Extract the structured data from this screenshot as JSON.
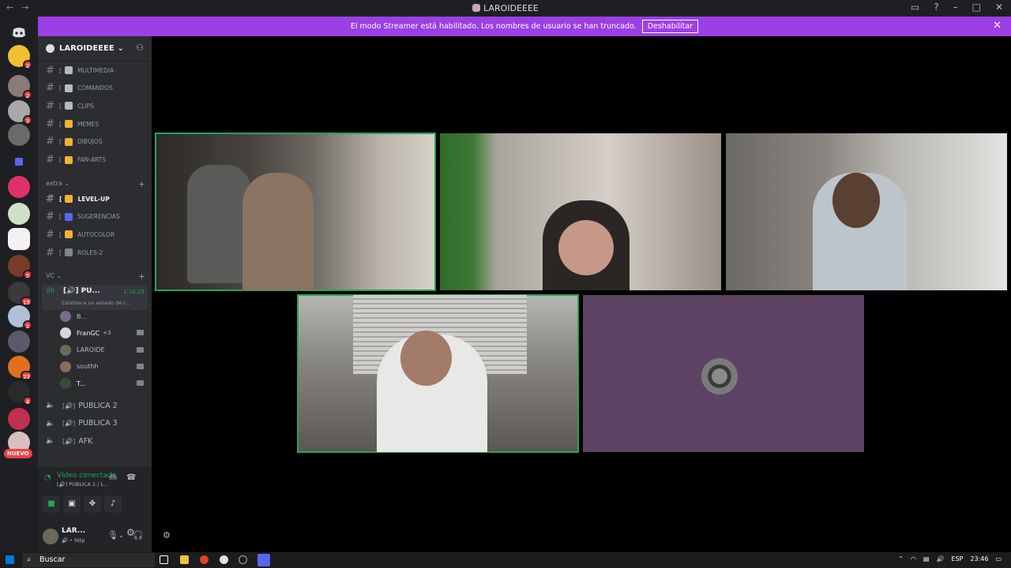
{
  "window": {
    "title": "LAROIDEEEE",
    "back_icon": "arrow-left-icon",
    "forward_icon": "arrow-right-icon"
  },
  "banner": {
    "text": "El modo Streamer está habilitado. Los nombres de usuario se han truncado.",
    "button": "Deshabilitar"
  },
  "server": {
    "name": "LAROIDEEEE"
  },
  "channels": [
    {
      "name": "MULTIMEDIA",
      "color": "#b5bac1"
    },
    {
      "name": "COMANDOS",
      "color": "#b5bac1"
    },
    {
      "name": "CLIPS",
      "color": "#b5bac1"
    },
    {
      "name": "MEMES",
      "color": "#f0b232"
    },
    {
      "name": "DIBUJOS",
      "color": "#f0b232"
    },
    {
      "name": "FAN-ARTS",
      "color": "#f0b232"
    }
  ],
  "extra_category": "extra",
  "extra_channels": [
    {
      "name": "LEVEL-UP",
      "color": "#f0b232",
      "bright": true
    },
    {
      "name": "SUGERENCIAS",
      "color": "#5865f2",
      "bright": false
    },
    {
      "name": "AUTOCOLOR",
      "color": "#f0b232",
      "bright": false
    },
    {
      "name": "ROLES-2",
      "color": "#80848e",
      "bright": false
    }
  ],
  "vc_category": "VC",
  "active_vc": {
    "name": "PU...",
    "time": "1:10:25",
    "status": "Establece un estado de c..."
  },
  "vc_users": [
    {
      "name": "B...",
      "color": "#7b6b8a"
    },
    {
      "name": "FranGC",
      "color": "#d8d8d8",
      "extra": "+3"
    },
    {
      "name": "LAROIDE",
      "color": "#6b6a5a"
    },
    {
      "name": "southh",
      "color": "#8a6a5a"
    },
    {
      "name": "T...",
      "color": "#3a4a3a"
    }
  ],
  "other_vcs": [
    {
      "name": "PUBLICA 2"
    },
    {
      "name": "PUBLICA 3"
    },
    {
      "name": "AFK"
    }
  ],
  "voice_panel": {
    "status": "Vídeo conectado",
    "channel": "PUBLICA 1 / L..."
  },
  "user_panel": {
    "name": "LAR...",
    "status": "http"
  },
  "rail_badges": [
    "2",
    "2",
    "3",
    "5",
    "15",
    "1",
    "23",
    "4"
  ],
  "rail_nuevo": "NUEVO",
  "taskbar": {
    "search": "Buscar",
    "lang": "ESP",
    "time": "23:46"
  }
}
